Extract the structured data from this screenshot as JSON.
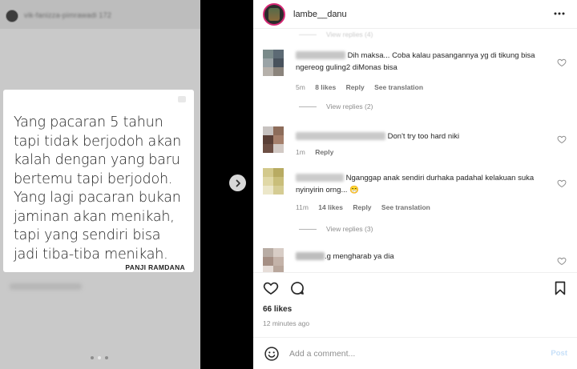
{
  "story": {
    "username": "vik-fanizza-pimrawadi 172",
    "quote_lines": [
      "Yang pacaran 5 tahun",
      "tapi tidak berjodoh akan",
      "kalah dengan yang baru",
      "bertemu tapi berjodoh.",
      "Yang lagi pacaran bukan",
      "jaminan akan menikah,",
      "tapi yang sendiri bisa",
      "jadi tiba-tiba menikah."
    ],
    "author": "PANJI RAMDANA",
    "progress": {
      "current": 1,
      "total": 3
    }
  },
  "post": {
    "username": "lambe__danu",
    "top_partial": "View replies (4)",
    "comments": [
      {
        "name_color": "#c6c6c6",
        "text": "Dih maksa... Coba kalau pasangannya yg di tikung bisa ngereog guling2 diMonas bisa",
        "time": "5m",
        "likes": "8 likes",
        "reply": "Reply",
        "translation": "See translation",
        "view_replies": "View replies (2)"
      },
      {
        "name_color": "#c9c9c9",
        "text": "Don't try too hard niki",
        "time": "1m",
        "reply": "Reply"
      },
      {
        "name_color": "#cbcbcb",
        "text": "Nganggap anak sendiri durhaka padahal kelakuan suka nyinyirin orng... 😁",
        "time": "11m",
        "likes": "14 likes",
        "reply": "Reply",
        "translation": "See translation",
        "view_replies": "View replies (3)"
      },
      {
        "name_color": "#bdbdbd",
        "text": ".g mengharab ya dia"
      }
    ],
    "likes": "66 likes",
    "time_ago": "12 minutes ago",
    "add_comment_placeholder": "Add a comment...",
    "post_label": "Post"
  },
  "icons": {
    "more": "more-horizontal-icon",
    "like": "heart-icon",
    "comment": "comment-bubble-icon",
    "save": "bookmark-icon",
    "emoji": "emoji-icon",
    "next": "chevron-right-icon"
  },
  "colors": {
    "story_bg": "#c9c9c9",
    "panel_bg": "#ffffff",
    "text_primary": "#262626",
    "text_secondary": "#8e8e8e",
    "post_button_disabled": "#c7e0f9",
    "avatar_ring": "#d62976"
  }
}
